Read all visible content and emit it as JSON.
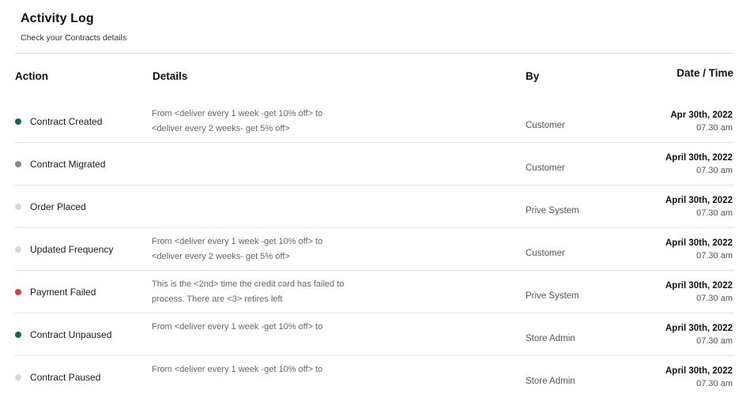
{
  "page": {
    "title": "Activity Log",
    "subtitle": "Check your Contracts details"
  },
  "columns": {
    "action": "Action",
    "details": "Details",
    "by": "By",
    "date_time": "Date / Time"
  },
  "status_colors": {
    "green": "#1d5e57",
    "gray": "#8a8a8a",
    "light": "#d8d8d8",
    "red": "#c94444"
  },
  "rows": [
    {
      "action": "Contract Created",
      "status": "green",
      "details_line1": "From <deliver every 1 week -get 10% off> to",
      "details_line2": "<deliver every 2 weeks- get 5% off>",
      "by": "Customer",
      "date": "Apr 30th, 2022",
      "time": "07.30 am"
    },
    {
      "action": "Contract Migrated",
      "status": "gray",
      "details_line1": "",
      "details_line2": "",
      "by": "Customer",
      "date": "April 30th, 2022",
      "time": "07.30 am"
    },
    {
      "action": "Order Placed",
      "status": "light",
      "details_line1": "",
      "details_line2": "",
      "by": "Prive System",
      "date": "April 30th, 2022",
      "time": "07.30 am"
    },
    {
      "action": "Updated Frequency",
      "status": "light",
      "details_line1": "From <deliver every 1 week -get 10% off> to",
      "details_line2": "<deliver every 2 weeks- get 5% off>",
      "by": "Customer",
      "date": "April 30th, 2022",
      "time": "07.30 am"
    },
    {
      "action": "Payment Failed",
      "status": "red",
      "details_line1": "This is the <2nd> time the credit card has failed to",
      "details_line2": "process. There are <3> retires left",
      "by": "Prive System",
      "date": "April 30th, 2022",
      "time": "07.30 am"
    },
    {
      "action": "Contract Unpaused",
      "status": "green",
      "details_line1": "From <deliver every 1 week -get 10% off> to",
      "details_line2": "",
      "by": "Store Admin",
      "date": "April 30th, 2022",
      "time": "07.30 am"
    },
    {
      "action": "Contract Paused",
      "status": "light",
      "details_line1": "From <deliver every 1 week -get 10% off> to",
      "details_line2": "",
      "by": "Store Admin",
      "date": "April 30th, 2022",
      "time": "07.30 am"
    }
  ]
}
